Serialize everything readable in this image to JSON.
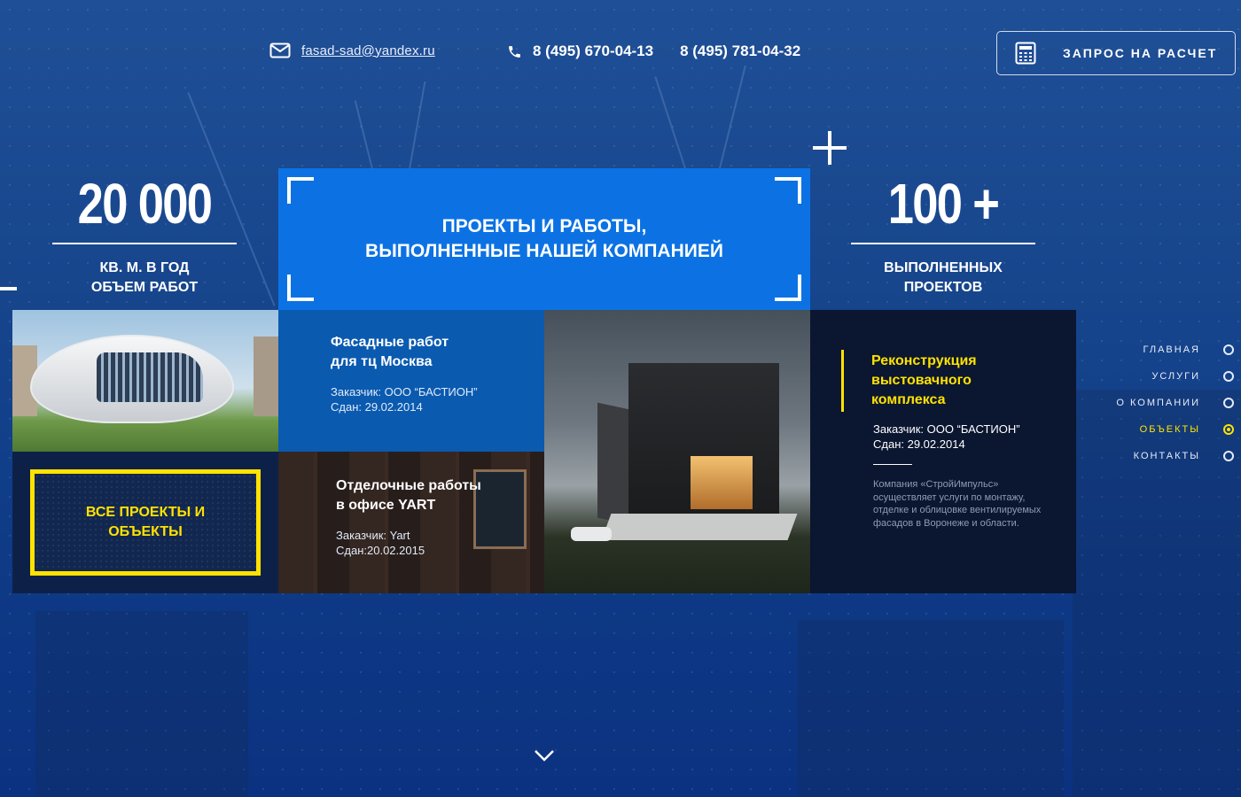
{
  "header": {
    "email": "fasad-sad@yandex.ru",
    "phones": [
      "8 (495) 670-04-13",
      "8 (495) 781-04-32"
    ],
    "request_button": "ЗАПРОС НА РАСЧЕТ",
    "icons": {
      "email": "mail-icon",
      "phone": "phone-icon",
      "request": "calculator-icon"
    }
  },
  "stats": [
    {
      "value": "20 000",
      "caption_line1": "КВ. М. В ГОД",
      "caption_line2": "ОБЪЕМ РАБОТ"
    },
    {
      "value": "100 +",
      "caption_line1": "ВЫПОЛНЕННЫХ",
      "caption_line2": "ПРОЕКТОВ"
    }
  ],
  "hero": {
    "line1": "ПРОЕКТЫ И РАБОТЫ,",
    "line2": "ВЫПОЛНЕННЫЕ НАШЕЙ КОМПАНИЕЙ"
  },
  "all_projects": {
    "line1": "ВСЕ ПРОЕКТЫ И",
    "line2": "ОБЪЕКТЫ"
  },
  "projects": [
    {
      "title_line1": "Фасадные работ",
      "title_line2": "для тц Москва",
      "customer": "Заказчик: ООО “БАСТИОН”",
      "date": "Сдан: 29.02.2014"
    },
    {
      "title_line1": "Отделочные работы",
      "title_line2": "в офисе YART",
      "customer": "Заказчик: Yart",
      "date": "Сдан:20.02.2015"
    }
  ],
  "featured": {
    "title_line1": "Реконструкция",
    "title_line2": "выстовачного",
    "title_line3": "комплекса",
    "customer": "Заказчик: ООО “БАСТИОН”",
    "date": "Сдан: 29.02.2014",
    "description": "Компания «СтройИмпульс» осуществляет услуги по монтажу, отделке и облицовке вентилируемых фасадов в Воронеже и области."
  },
  "side_nav": [
    {
      "label": "ГЛАВНАЯ",
      "active": false
    },
    {
      "label": "УСЛУГИ",
      "active": false
    },
    {
      "label": "О КОМПАНИИ",
      "active": false
    },
    {
      "label": "ОБЪЕКТЫ",
      "active": true
    },
    {
      "label": "КОНТАКТЫ",
      "active": false
    }
  ],
  "colors": {
    "accent_yellow": "#ffe200",
    "hero_blue": "#0c72e4",
    "background": "#17468d"
  }
}
